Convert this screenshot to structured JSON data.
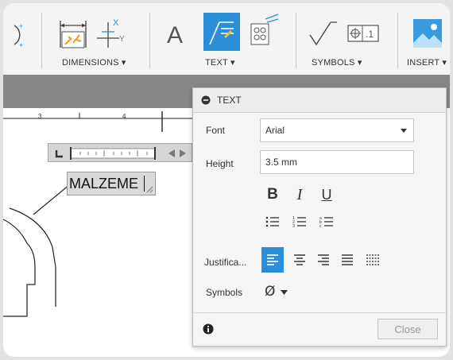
{
  "toolbar": {
    "groups": [
      {
        "label": "DIMENSIONS ▾"
      },
      {
        "label": "TEXT ▾"
      },
      {
        "label": "SYMBOLS ▾"
      },
      {
        "label": "INSERT ▾"
      }
    ]
  },
  "ruler": {
    "ticks": [
      "3",
      "4"
    ]
  },
  "drawing": {
    "text_value": "MALZEME"
  },
  "panel": {
    "title": "TEXT",
    "font_label": "Font",
    "font_value": "Arial",
    "height_label": "Height",
    "height_value": "3.5 mm",
    "justification_label": "Justifica...",
    "symbols_label": "Symbols",
    "symbol_value": "Ø",
    "close_label": "Close"
  },
  "colors": {
    "accent": "#2a8fd8",
    "toolbar_bg": "#f4f4f4",
    "band": "#878787",
    "panel_bg": "#f6f6f6"
  }
}
